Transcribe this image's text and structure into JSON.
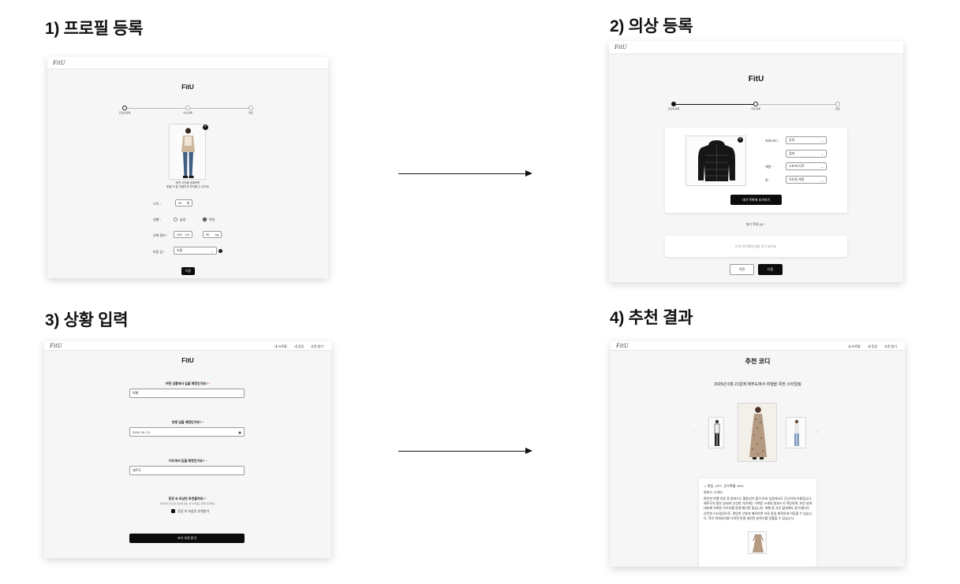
{
  "steps": {
    "s1": {
      "title": "1) 프로필 등록"
    },
    "s2": {
      "title": "2) 의상 등록"
    },
    "s3": {
      "title": "3) 상황 입력"
    },
    "s4": {
      "title": "4) 추천 결과"
    }
  },
  "app": {
    "logo": "FitU",
    "brand": "FitU"
  },
  "profile": {
    "progress": [
      "프로필 등록",
      "의상 등록",
      "완료"
    ],
    "photo_help": [
      "정면 사진을 등록하면",
      "옷을 더 잘 어울리게 보여줄 수 있어요"
    ],
    "age_label": "나이",
    "age_value": "30",
    "age_unit": "세",
    "gender_label": "성별",
    "gender_male": "남성",
    "gender_female": "여성",
    "body_label": "신체 정보",
    "height_value": "165",
    "height_unit": "cm",
    "weight_value": "50",
    "weight_unit": "kg",
    "fit_label": "피팅 감",
    "fit_value": "보통",
    "next_button": "다음"
  },
  "clothes": {
    "progress": [
      "프로필 등록",
      "의상 등록",
      "완료"
    ],
    "category_label": "카테고리",
    "category_value": "상의",
    "category_sub_value": "점퍼",
    "season_label": "계절",
    "season_value": "스포츠/기로",
    "fit_label": "핏",
    "fit_value": "이유용 계절",
    "add_button": "대기 목록에 추가하기",
    "queue_label": "대기 목록 (0)",
    "queue_empty": "아직 대기열에 넣을 옷이 없어요.",
    "prev_button": "이전",
    "next_button": "다음"
  },
  "situation": {
    "nav": [
      "내 프로필",
      "내 옷장",
      "추천 받기"
    ],
    "q1_label": "어떤 상황에서 입을 예정인가요?",
    "q1_value": "여행",
    "q2_label": "언제 입을 예정인가요?",
    "q2_value": "2025. 06. 21.",
    "q3_label": "어디에서 입을 예정인가요?",
    "q3_value": "제주도",
    "q4_label": "옷장 속 의상만 추천할까요?",
    "q4_help": "체크하지 않으면 옷장에 없는 새 아이템도 함께 추천해요.",
    "q4_check": "옷장 속 의상만 추천받기",
    "submit_button": "코디 추천 받기"
  },
  "result": {
    "nav": [
      "내 프로필",
      "내 옷장",
      "추천 받기"
    ],
    "title": "추천 코디",
    "subtitle": "2025년 6월 21일에 제주도에서 여행을 위한 스타일링",
    "weather": "맑음, 18°C, 강수확률: 60%",
    "item_line": "원피스: 드레스",
    "description": "편안한 여행 의류 중 원피스는 활동성이 좋아 야외 일정에서도 무난하게 어울립니다. 제주도의 맑은 날씨와 선선한 기온에는 가벼운 소재의 원피스가 적당하며, 흐린 날에 대비해 가벼운 아우터를 함께 챙기면 좋습니다. 여행 중 사진 촬영에도 잘 어울리는 산뜻한 스타일링으로, 편안한 신발과 매치하면 하루 종일 쾌적하게 이동할 수 있습니다. 작은 액세서리를 더하면 한층 세련된 분위기를 연출할 수 있습니다."
  }
}
